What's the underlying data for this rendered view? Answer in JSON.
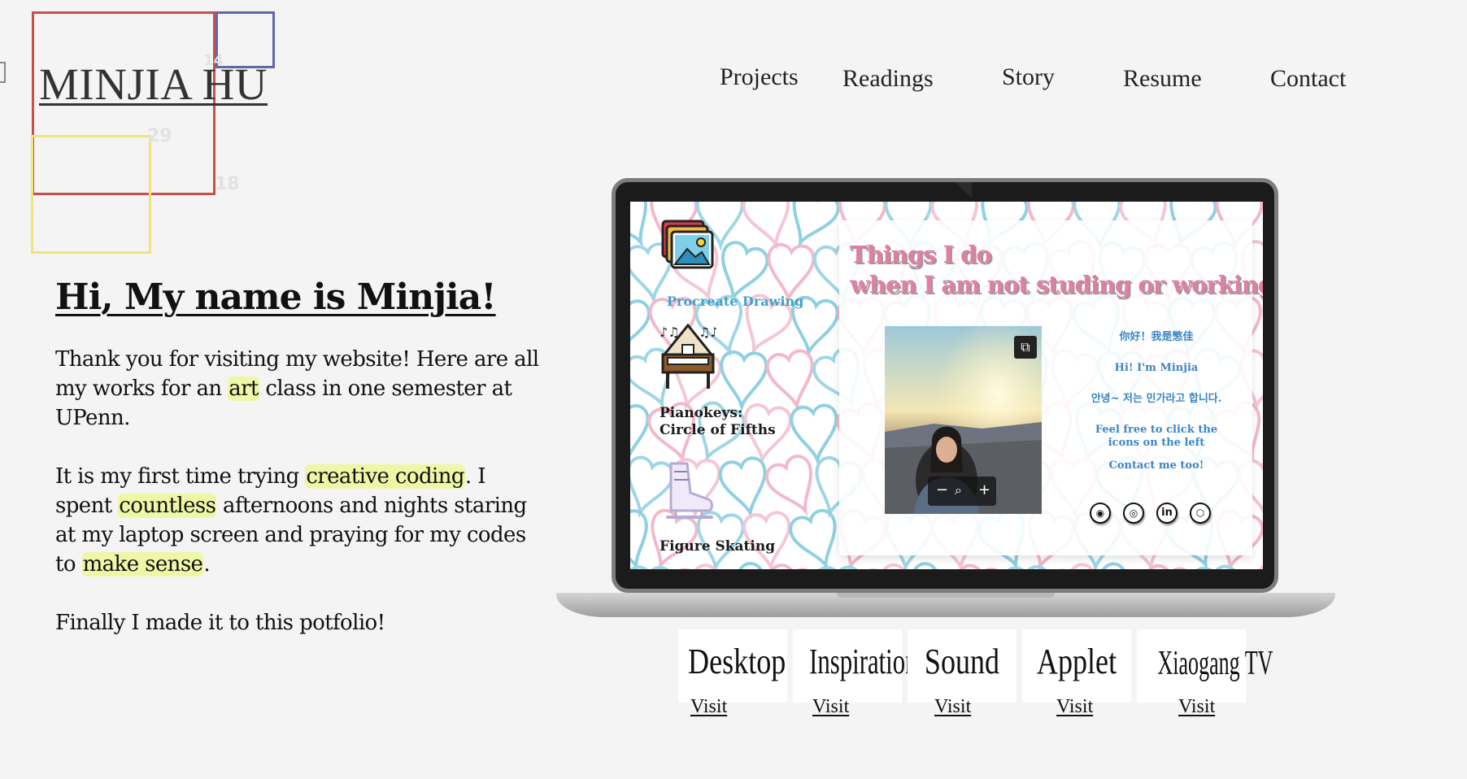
{
  "logo": {
    "name": "MINJIA HU",
    "square_numbers": [
      "14",
      "29",
      "18"
    ],
    "colors": {
      "red": "#c8504a",
      "blue": "#6366a8",
      "yellow": "#f2e37a"
    }
  },
  "nav": {
    "items": [
      {
        "label": "Projects"
      },
      {
        "label": "Readings"
      },
      {
        "label": "Story"
      },
      {
        "label": "Resume"
      },
      {
        "label": "Contact"
      }
    ]
  },
  "intro": {
    "heading": "Hi, My name is Minjia!",
    "p1": {
      "a": "Thank you for visiting my website! Here are all my works for an ",
      "hl": "art",
      "b": " class in one semester at UPenn."
    },
    "p2": {
      "a": "It is my first time trying ",
      "hl1": "creative coding",
      "b": ". I spent ",
      "hl2": "countless",
      "c": " afternoons and nights staring at my laptop screen and praying for my codes to ",
      "hl3": "make sense",
      "d": "."
    },
    "p3": "Finally I made it to this potfolio!",
    "highlight_color": "#eef7a6"
  },
  "laptop_screen": {
    "sidebar": [
      {
        "label": "Procreate Drawing",
        "icon": "gallery-icon"
      },
      {
        "label": "Pianokeys:\nCircle of Fifths",
        "icon": "piano-icon"
      },
      {
        "label": "Figure Skating",
        "icon": "skate-icon"
      }
    ],
    "card": {
      "title_line1": "Things I do",
      "title_line2": "when I am not studing or working",
      "lines": [
        "你好！我是慜佳",
        "Hi! I'm Minjia",
        "안녕~ 저는 민가라고 합니다.",
        "Feel free to click the icons on the left",
        "Contact me too!"
      ],
      "zoom_controls": [
        "−",
        "⌕",
        "+"
      ],
      "socials": [
        {
          "name": "github-icon",
          "glyph": "◉"
        },
        {
          "name": "instagram-icon",
          "glyph": "◎"
        },
        {
          "name": "linkedin-icon",
          "glyph": "in"
        },
        {
          "name": "codepen-icon",
          "glyph": "⬡"
        }
      ],
      "title_color": "#e07fa4",
      "text_color": "#3b86c4"
    }
  },
  "projects": [
    {
      "title": "Desktop",
      "link": "Visit"
    },
    {
      "title": "Inspiration",
      "link": "Visit"
    },
    {
      "title": "Sound",
      "link": "Visit"
    },
    {
      "title": "Applet",
      "link": "Visit"
    },
    {
      "title": "Xiaogang TV",
      "link": "Visit"
    }
  ]
}
